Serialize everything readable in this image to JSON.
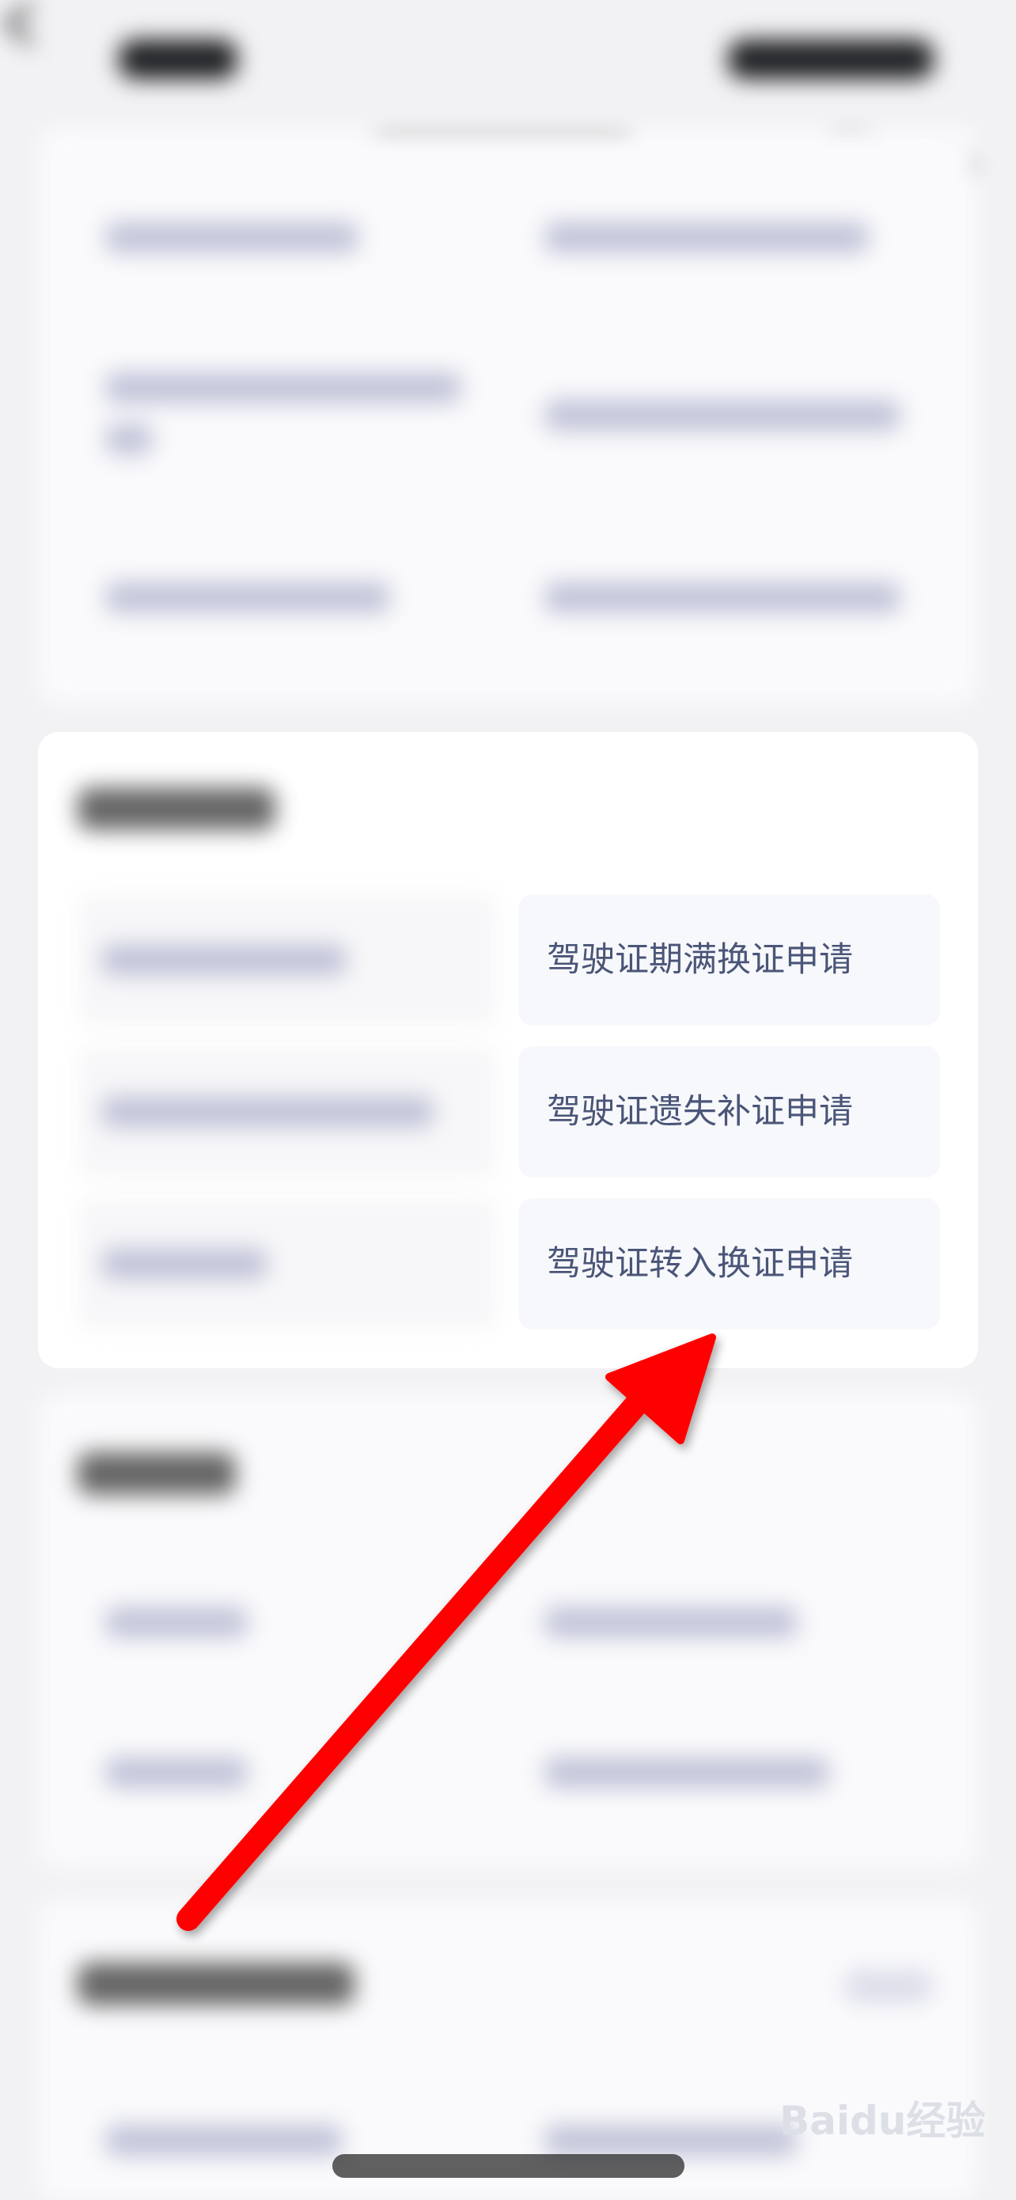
{
  "mid_card": {
    "items": [
      {
        "label": "驾驶证期满换证申请"
      },
      {
        "label": "驾驶证遗失补证申请"
      },
      {
        "label": "驾驶证转入换证申请"
      }
    ]
  },
  "watermark": "Baidu经验"
}
